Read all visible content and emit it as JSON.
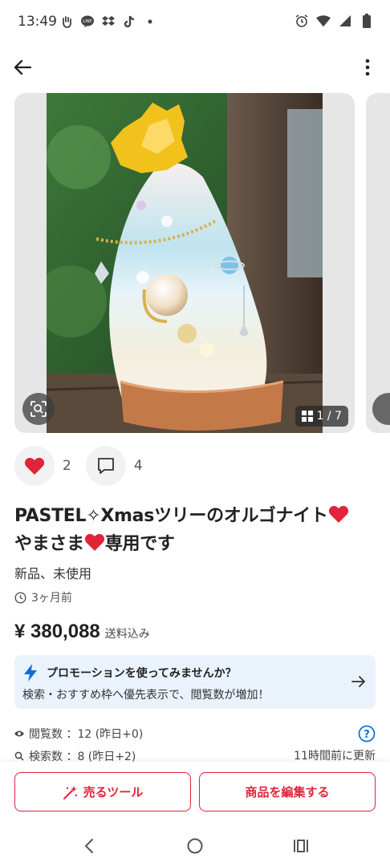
{
  "status_bar": {
    "time": "13:49"
  },
  "carousel": {
    "counter": "1 / 7"
  },
  "reactions": {
    "likes": "2",
    "comments": "4"
  },
  "item": {
    "title_part1": "PASTEL✧Xmasツリーのオルゴナイト",
    "title_part2": "やまさま",
    "title_part3": "専用です",
    "condition": "新品、未使用",
    "posted": "3ヶ月前",
    "price": "¥ 380,088",
    "shipping": "送料込み"
  },
  "promo": {
    "title": "プロモーションを使ってみませんか？",
    "description": "検索・おすすめ枠へ優先表示で、閲覧数が増加！"
  },
  "stats": {
    "views": "閲覧数 ：12 (昨日+0)",
    "searches": "検索数 ：8 (昨日+2)",
    "updated": "11時間前に更新"
  },
  "actions": {
    "sell_tool": "売るツール",
    "edit_item": "商品を編集する"
  },
  "colors": {
    "accent": "#e0243a",
    "promo_bg": "#eaf3fc",
    "promo_icon": "#0a6fd6"
  }
}
